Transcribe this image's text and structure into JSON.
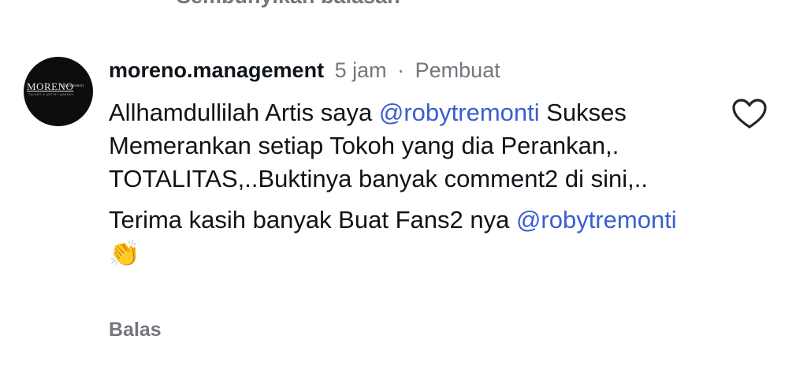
{
  "thread": {
    "hide_replies_label": "Sembunyikan balasan"
  },
  "comment": {
    "avatar": {
      "logo_text": "MORENO",
      "logo_subtext": "MANAGEMENT",
      "logo_tagline": "TALENT & ARTIST AGENCY"
    },
    "username": "moreno.management",
    "time": "5 jam",
    "separator": "·",
    "role": "Pembuat",
    "line1_prefix": "Allhamdullilah Artis saya ",
    "line1_mention": "@robytremonti",
    "line1_rest": " Sukses Memerankan setiap Tokoh yang dia Perankan,. TOTALITAS,..Buktinya banyak comment2 di sini,..",
    "para2_text": "Terima kasih banyak Buat Fans2 nya ",
    "para2_mention": "@robytremonti",
    "para2_emoji": "👏",
    "reply_label": "Balas",
    "like_icon": "heart-outline-icon"
  }
}
